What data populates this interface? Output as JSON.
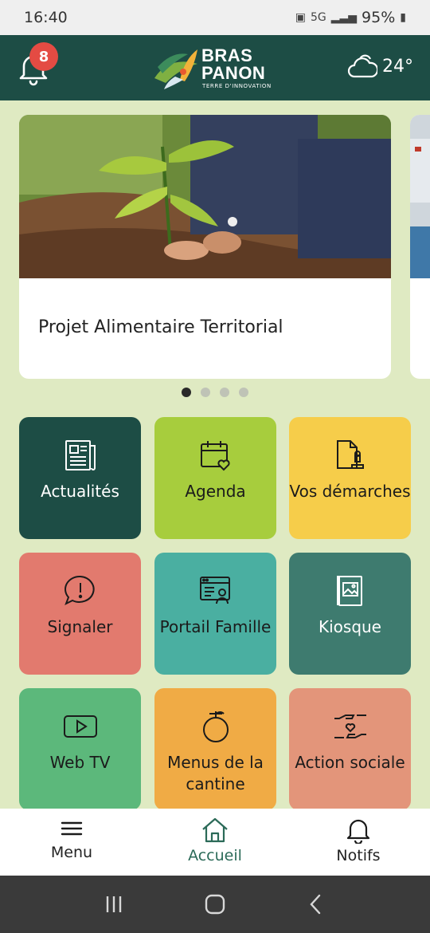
{
  "status_bar": {
    "time": "16:40",
    "network": "5G",
    "battery": "95%"
  },
  "header": {
    "notification_count": "8",
    "logo": {
      "line1": "BRAS",
      "line2": "PANON",
      "tagline": "TERRE D'INNOVATION"
    },
    "weather": {
      "icon": "cloud-icon",
      "temperature": "24°"
    }
  },
  "carousel": {
    "slides": [
      {
        "title": "Projet Alimentaire Territorial"
      }
    ],
    "active_index": 0,
    "dot_count": 4
  },
  "tiles": [
    {
      "label": "Actualités",
      "icon": "newspaper-icon",
      "color": "#1d4d45"
    },
    {
      "label": "Agenda",
      "icon": "calendar-heart-icon",
      "color": "#a7cd3d"
    },
    {
      "label": "Vos démarches",
      "icon": "document-stamp-icon",
      "color": "#f6cd4a"
    },
    {
      "label": "Signaler",
      "icon": "alert-bubble-icon",
      "color": "#e27a6e"
    },
    {
      "label": "Portail Famille",
      "icon": "family-portal-icon",
      "color": "#4aafa1"
    },
    {
      "label": "Kiosque",
      "icon": "magazine-icon",
      "color": "#3e7b6f"
    },
    {
      "label": "Web TV",
      "icon": "play-icon",
      "color": "#5cb87b"
    },
    {
      "label": "Menus de la cantine",
      "icon": "fruit-icon",
      "color": "#f0ab45"
    },
    {
      "label": "Action sociale",
      "icon": "hands-heart-icon",
      "color": "#e3957a"
    }
  ],
  "bottom_nav": {
    "items": [
      {
        "label": "Menu",
        "icon": "hamburger-icon"
      },
      {
        "label": "Accueil",
        "icon": "home-icon"
      },
      {
        "label": "Notifs",
        "icon": "bell-icon"
      }
    ],
    "active": "Accueil"
  }
}
